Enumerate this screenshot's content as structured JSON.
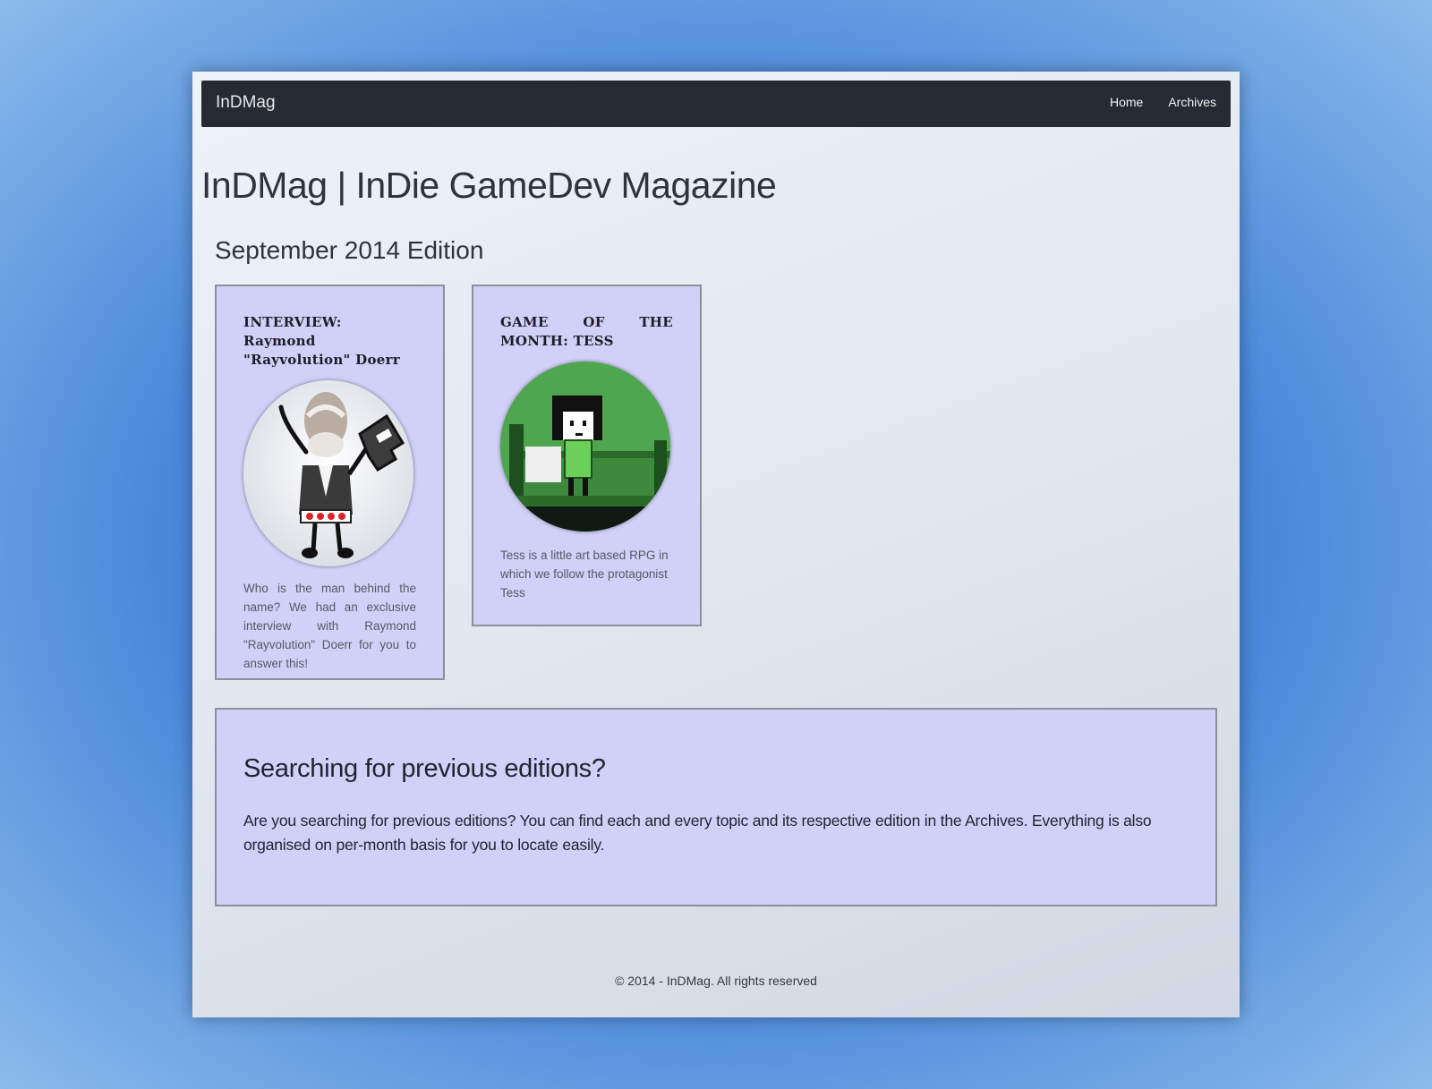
{
  "navbar": {
    "brand": "InDMag",
    "links": [
      {
        "label": "Home"
      },
      {
        "label": "Archives"
      }
    ]
  },
  "site_title": "InDMag | InDie GameDev Magazine",
  "edition_title": "September 2014 Edition",
  "cards": [
    {
      "title": "INTERVIEW: Raymond \"Rayvolution\" Doerr",
      "image_icon": "interview-portrait-image",
      "text": "Who is the man behind the name? We had an exclusive interview with Raymond \"Rayvolution\" Doerr for you to answer this!"
    },
    {
      "title": "GAME OF THE MONTH: TESS",
      "image_icon": "tess-pixel-art-image",
      "text": "Tess is a little art based RPG in which we follow the protagonist Tess"
    }
  ],
  "previous_editions": {
    "title": "Searching for previous editions?",
    "text": "Are you searching for previous editions? You can find each and every topic and its respective edition in the Archives. Everything is also organised on per-month basis for you to locate easily."
  },
  "footer": "© 2014 - InDMag. All rights reserved",
  "colors": {
    "navbar": "#262a33",
    "card_bg": "#d0d0f8",
    "card_border": "#8d8f99",
    "background_blue": "#4a88da"
  }
}
